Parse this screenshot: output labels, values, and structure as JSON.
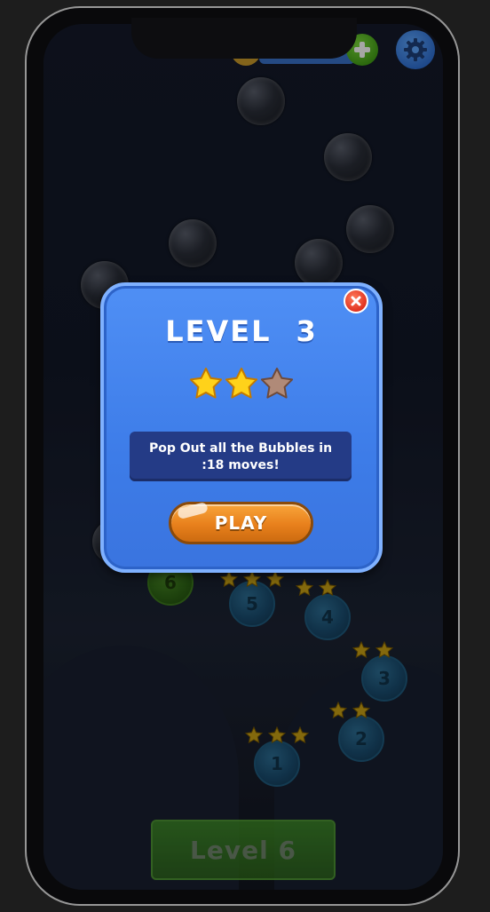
{
  "modal": {
    "title": "LEVEL",
    "level_number": "3",
    "stars_earned": 2,
    "stars_total": 3,
    "instruction": "Pop Out all the Bubbles in :18 moves!",
    "play_label": "PLAY"
  },
  "map": {
    "nodes": [
      {
        "label": "1",
        "stars": 3
      },
      {
        "label": "2",
        "stars": 2
      },
      {
        "label": "3",
        "stars": 2
      },
      {
        "label": "4",
        "stars": 2
      },
      {
        "label": "5",
        "stars": 3
      },
      {
        "label": "6",
        "stars": 0
      }
    ]
  },
  "bottom_button": {
    "label": "Level 6"
  },
  "hud": {
    "add_icon": "plus-icon",
    "settings_icon": "gear-icon"
  },
  "colors": {
    "modal_blue": "#4f8ff5",
    "play_orange": "#e8801c",
    "star_gold": "#ffd21a",
    "star_empty": "#b08a78",
    "close_red": "#e03320"
  }
}
